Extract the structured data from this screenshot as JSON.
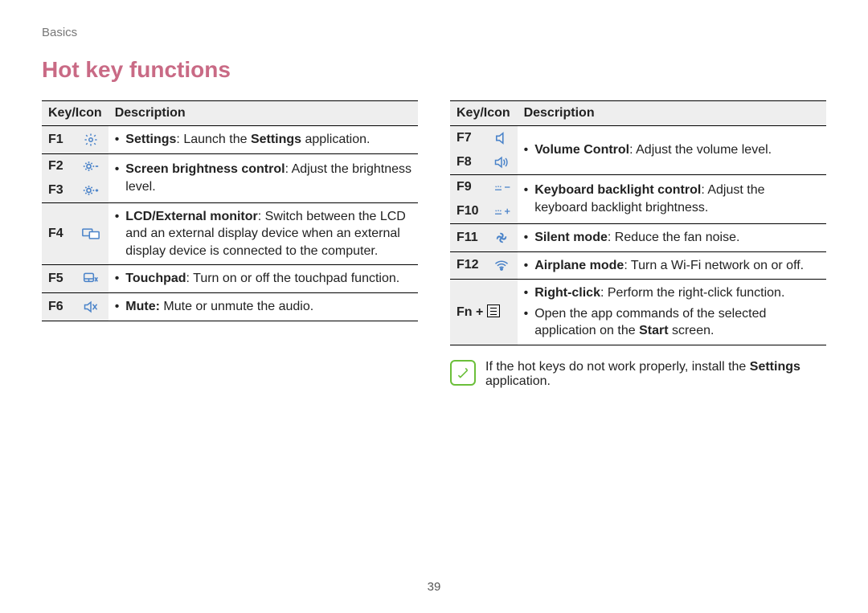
{
  "breadcrumb": "Basics",
  "heading": "Hot key functions",
  "table": {
    "head_key": "Key/Icon",
    "head_desc": "Description"
  },
  "t1": {
    "r1": {
      "key": "F1",
      "bold": "Settings",
      "sep": ": Launch the ",
      "bold2": "Settings",
      "tail": " application."
    },
    "r2": {
      "key": "F2"
    },
    "r3": {
      "key": "F3",
      "bold": "Screen brightness control",
      "tail": ": Adjust the brightness level."
    },
    "r4": {
      "key": "F4",
      "bold": "LCD/External monitor",
      "tail": ": Switch between the LCD and an external display device when an external display device is connected to the computer."
    },
    "r5": {
      "key": "F5",
      "bold": "Touchpad",
      "tail": ": Turn on or off the touchpad function."
    },
    "r6": {
      "key": "F6",
      "bold": "Mute:",
      "tail": " Mute or unmute the audio."
    }
  },
  "t2": {
    "r1": {
      "key": "F7"
    },
    "r2": {
      "key": "F8",
      "bold": "Volume Control",
      "tail": ": Adjust the volume level."
    },
    "r3": {
      "key": "F9"
    },
    "r4": {
      "key": "F10",
      "bold": "Keyboard backlight control",
      "tail": ": Adjust the keyboard backlight brightness."
    },
    "r5": {
      "key": "F11",
      "bold": "Silent mode",
      "tail": ": Reduce the fan noise."
    },
    "r6": {
      "key": "F12",
      "bold": "Airplane mode",
      "tail": ": Turn a Wi-Fi network on or off."
    },
    "r7": {
      "key": "Fn + ",
      "b1_bold": "Right-click",
      "b1_tail": ": Perform the right-click function.",
      "b2_pre": "Open the app commands of the selected application on the ",
      "b2_bold": "Start",
      "b2_post": " screen."
    }
  },
  "note": {
    "pre": "If the hot keys do not work properly, install the ",
    "bold": "Settings",
    "post": " application."
  },
  "pagenum": "39"
}
